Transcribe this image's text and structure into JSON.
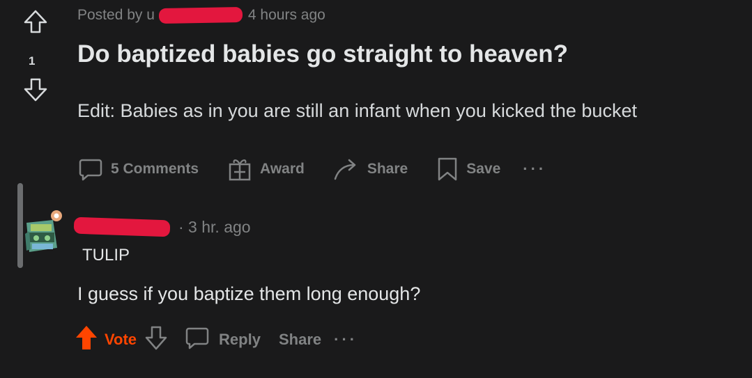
{
  "post": {
    "score": "1",
    "posted_by_prefix": "Posted by u",
    "time_ago": "4 hours ago",
    "title": "Do baptized babies go straight to heaven?",
    "body": "Edit: Babies as in you are still an infant when you kicked the bucket",
    "actions": {
      "comments": "5 Comments",
      "award": "Award",
      "share": "Share",
      "save": "Save",
      "more": "···"
    }
  },
  "comment": {
    "time_ago": "· 3 hr. ago",
    "flair": "TULIP",
    "body": "I guess if you baptize them long enough?",
    "actions": {
      "vote": "Vote",
      "reply": "Reply",
      "share": "Share",
      "more": "···"
    }
  },
  "colors": {
    "background": "#1a1a1b",
    "text": "#d7dadc",
    "muted": "#818384",
    "upvote": "#ff4500",
    "redaction": "#e3173e"
  }
}
